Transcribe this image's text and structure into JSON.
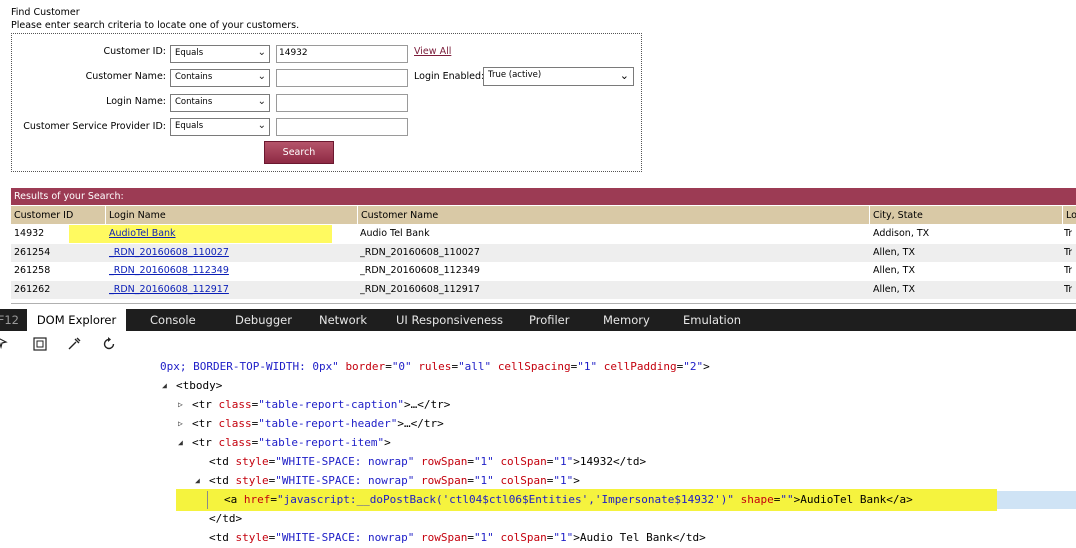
{
  "page": {
    "title": "Find Customer",
    "subtitle": "Please enter search criteria to locate one of your customers."
  },
  "form": {
    "fields": [
      {
        "label": "Customer ID:",
        "operator": "Equals",
        "value": "14932"
      },
      {
        "label": "Customer Name:",
        "operator": "Contains",
        "value": ""
      },
      {
        "label": "Login Name:",
        "operator": "Contains",
        "value": ""
      },
      {
        "label": "Customer Service Provider ID:",
        "operator": "Equals",
        "value": ""
      }
    ],
    "view_all": "View All",
    "login_enabled_label": "Login Enabled:",
    "login_enabled_value": "True (active)",
    "search_button": "Search"
  },
  "results": {
    "caption": "Results of your Search:",
    "headers": [
      "Customer ID",
      "Login Name",
      "Customer Name",
      "City, State",
      "Lo"
    ],
    "rows": [
      [
        "14932",
        "AudioTel Bank",
        "Audio Tel Bank",
        "Addison, TX",
        "Tr"
      ],
      [
        "261254",
        "_RDN_20160608_110027",
        "_RDN_20160608_110027",
        "Allen, TX",
        "Tr"
      ],
      [
        "261258",
        "_RDN_20160608_112349",
        "_RDN_20160608_112349",
        "Allen, TX",
        "Tr"
      ],
      [
        "261262",
        "_RDN_20160608_112917",
        "_RDN_20160608_112917",
        "Allen, TX",
        "Tr"
      ]
    ]
  },
  "devtools": {
    "f12_label": "F12",
    "tabs": [
      "DOM Explorer",
      "Console",
      "Debugger",
      "Network",
      "UI Responsiveness",
      "Profiler",
      "Memory",
      "Emulation"
    ],
    "active_tab": "DOM Explorer",
    "tree": {
      "l0": {
        "pre": "0px; BORDER-TOP-WIDTH: 0px\" ",
        "a1": "border",
        "v1": "\"0\"",
        "a2": "rules",
        "v2": "\"all\"",
        "a3": "cellSpacing",
        "v3": "\"1\"",
        "a4": "cellPadding",
        "v4": "\"2\"",
        "end": ">"
      },
      "l1": "<tbody>",
      "l2": {
        "open": "<tr ",
        "a": "class",
        "v": "\"table-report-caption\"",
        "end": ">…</tr>"
      },
      "l3": {
        "open": "<tr ",
        "a": "class",
        "v": "\"table-report-header\"",
        "end": ">…</tr>"
      },
      "l4": {
        "open": "<tr ",
        "a": "class",
        "v": "\"table-report-item\"",
        "end": ">"
      },
      "l5": {
        "open": "<td ",
        "a1": "style",
        "v1": "\"WHITE-SPACE: nowrap\"",
        "a2": "rowSpan",
        "v2": "\"1\"",
        "a3": "colSpan",
        "v3": "\"1\"",
        "end": ">14932</td>"
      },
      "l6": {
        "open": "<td ",
        "a1": "style",
        "v1": "\"WHITE-SPACE: nowrap\"",
        "a2": "rowSpan",
        "v2": "\"1\"",
        "a3": "colSpan",
        "v3": "\"1\"",
        "end": ">"
      },
      "l7": {
        "open": "<a ",
        "a1": "href",
        "v1": "\"javascript:__doPostBack('ctl04$ctl06$Entities','Impersonate$14932')\"",
        "a2": "shape",
        "v2": "\"\"",
        "end": ">AudioTel Bank</a>"
      },
      "l8": "</td>",
      "l9": {
        "open": "<td ",
        "a1": "style",
        "v1": "\"WHITE-SPACE: nowrap\"",
        "a2": "rowSpan",
        "v2": "\"1\"",
        "a3": "colSpan",
        "v3": "\"1\"",
        "end": ">Audio Tel Bank</td>"
      }
    }
  }
}
